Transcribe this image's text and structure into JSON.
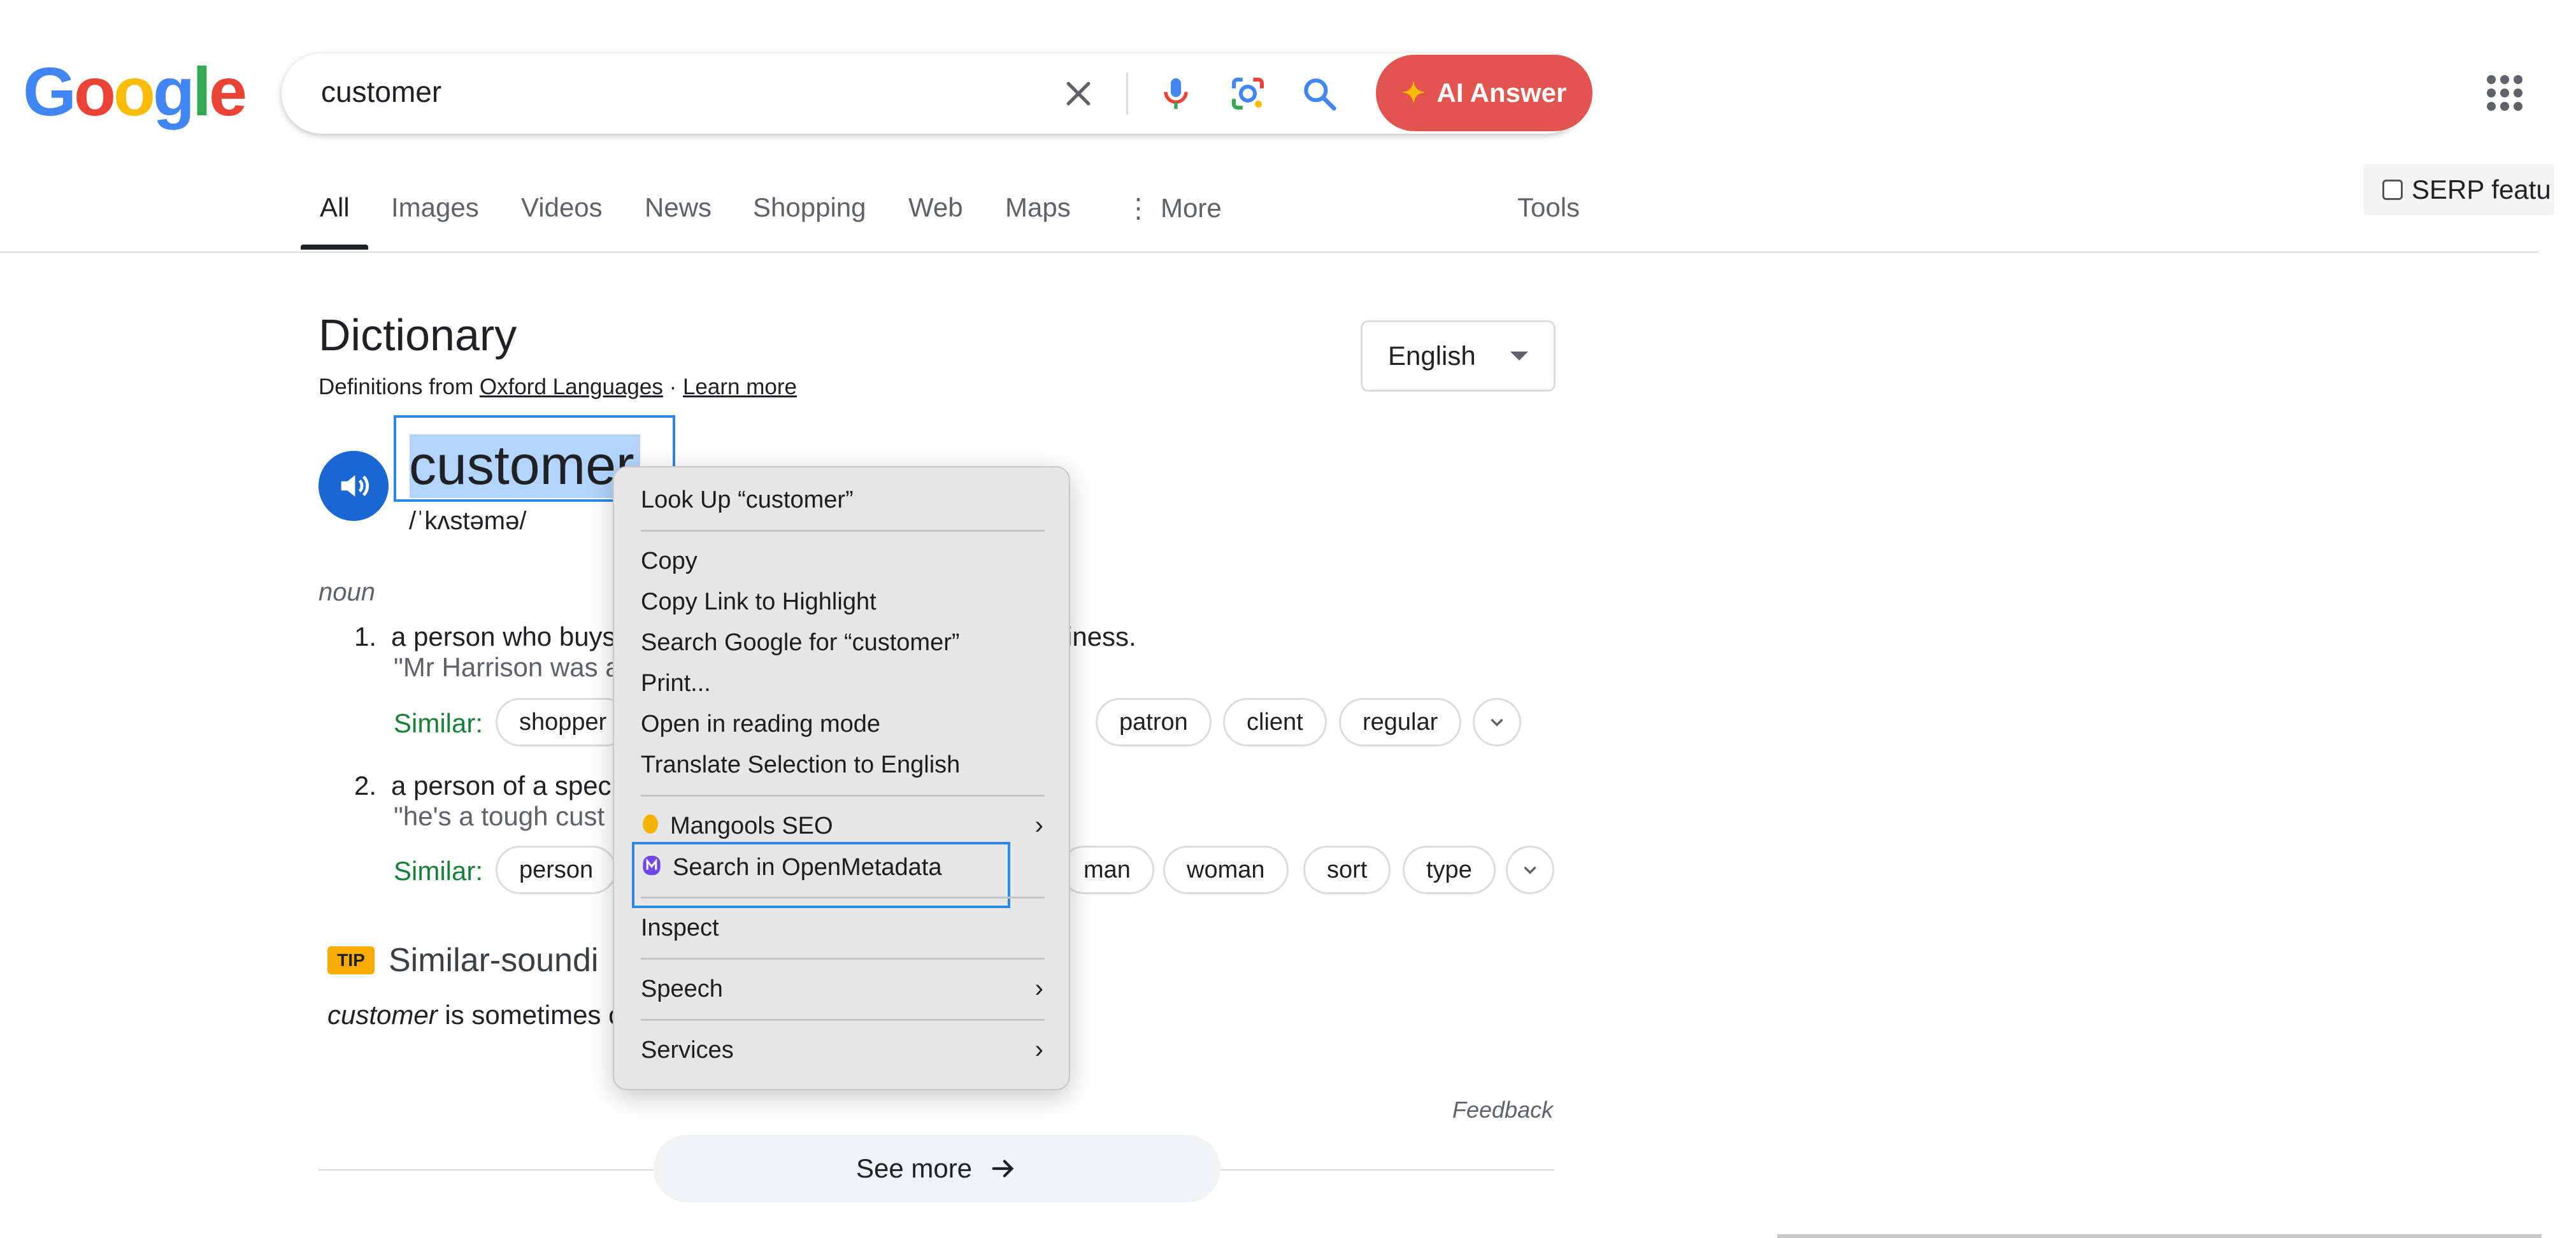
{
  "logo": {
    "letters": [
      "G",
      "o",
      "o",
      "g",
      "l",
      "e"
    ],
    "colors": [
      "#4285f4",
      "#ea4335",
      "#fbbc05",
      "#4285f4",
      "#34a853",
      "#ea4335"
    ]
  },
  "search": {
    "query": "customer"
  },
  "ai_answer": {
    "label": "AI Answer",
    "color": "#e2554e"
  },
  "tabs": [
    {
      "label": "All"
    },
    {
      "label": "Images"
    },
    {
      "label": "Videos"
    },
    {
      "label": "News"
    },
    {
      "label": "Shopping"
    },
    {
      "label": "Web"
    },
    {
      "label": "Maps"
    },
    {
      "label": "More"
    }
  ],
  "tools_label": "Tools",
  "serp_label": "SERP featu",
  "dictionary": {
    "title": "Dictionary",
    "sub_prefix": "Definitions from ",
    "sub_source": "Oxford Languages",
    "sub_sep": " · ",
    "sub_learn": "Learn more",
    "language": "English",
    "word": "customer",
    "phonetic": "/ˈkʌstəmə/",
    "part_of_speech": "noun",
    "definitions": [
      {
        "num": "1.",
        "text": "a person who buys",
        "text_tail": "iness.",
        "example": "\"Mr Harrison was a",
        "similar_label": "Similar:",
        "chips": [
          "shopper",
          "patron",
          "client",
          "regular"
        ]
      },
      {
        "num": "2.",
        "text": "a person of a spec",
        "example": "\"he's a tough cust",
        "similar_label": "Similar:",
        "chips": [
          "person",
          "man",
          "woman",
          "sort",
          "type"
        ]
      }
    ],
    "tip": "TIP",
    "similar_sounding_title": "Similar-soundi",
    "similar_sounding_word": "customer",
    "similar_sounding_rest": " is sometimes c",
    "feedback": "Feedback",
    "see_more": "See more"
  },
  "context_menu": {
    "look_up": "Look Up “customer”",
    "copy": "Copy",
    "copy_link": "Copy Link to Highlight",
    "search_google": "Search Google for “customer”",
    "print": "Print...",
    "reading_mode": "Open in reading mode",
    "translate": "Translate Selection to English",
    "mangools": "Mangools SEO",
    "openmetadata": "Search in OpenMetadata",
    "inspect": "Inspect",
    "speech": "Speech",
    "services": "Services"
  }
}
